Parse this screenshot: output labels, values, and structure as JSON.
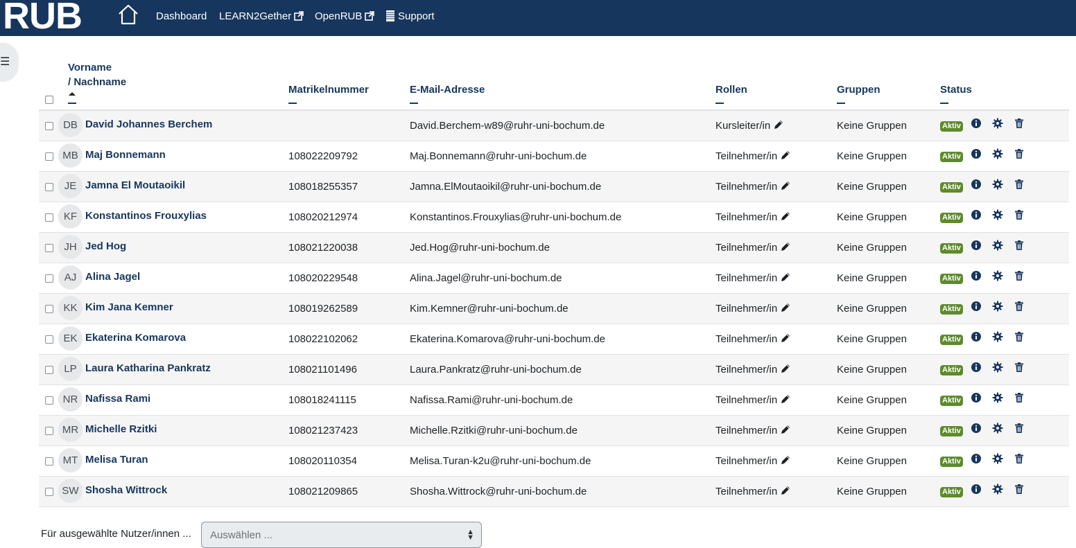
{
  "navbar": {
    "logo": "RUB",
    "links": [
      {
        "label": "Dashboard",
        "external": false
      },
      {
        "label": "LEARN2Gether",
        "external": true
      },
      {
        "label": "OpenRUB",
        "external": true
      },
      {
        "label": "Support",
        "icon": "support-icon"
      }
    ]
  },
  "table": {
    "headers": {
      "name_line1": "Vorname",
      "name_line2": "/ Nachname",
      "matrikel": "Matrikelnummer",
      "email": "E-Mail-Adresse",
      "roles": "Rollen",
      "groups": "Gruppen",
      "status": "Status"
    },
    "rows": [
      {
        "initials": "DB",
        "name": "David Johannes Berchem",
        "matrikel": "",
        "email": "David.Berchem-w89@ruhr-uni-bochum.de",
        "role": "Kursleiter/in",
        "groups": "Keine Gruppen",
        "status": "Aktiv"
      },
      {
        "initials": "MB",
        "name": "Maj Bonnemann",
        "matrikel": "108022209792",
        "email": "Maj.Bonnemann@ruhr-uni-bochum.de",
        "role": "Teilnehmer/in",
        "groups": "Keine Gruppen",
        "status": "Aktiv"
      },
      {
        "initials": "JE",
        "name": "Jamna El Moutaoikil",
        "matrikel": "108018255357",
        "email": "Jamna.ElMoutaoikil@ruhr-uni-bochum.de",
        "role": "Teilnehmer/in",
        "groups": "Keine Gruppen",
        "status": "Aktiv"
      },
      {
        "initials": "KF",
        "name": "Konstantinos Frouxylias",
        "matrikel": "108020212974",
        "email": "Konstantinos.Frouxylias@ruhr-uni-bochum.de",
        "role": "Teilnehmer/in",
        "groups": "Keine Gruppen",
        "status": "Aktiv"
      },
      {
        "initials": "JH",
        "name": "Jed Hog",
        "matrikel": "108021220038",
        "email": "Jed.Hog@ruhr-uni-bochum.de",
        "role": "Teilnehmer/in",
        "groups": "Keine Gruppen",
        "status": "Aktiv"
      },
      {
        "initials": "AJ",
        "name": "Alina Jagel",
        "matrikel": "108020229548",
        "email": "Alina.Jagel@ruhr-uni-bochum.de",
        "role": "Teilnehmer/in",
        "groups": "Keine Gruppen",
        "status": "Aktiv"
      },
      {
        "initials": "KK",
        "name": "Kim Jana Kemner",
        "matrikel": "108019262589",
        "email": "Kim.Kemner@ruhr-uni-bochum.de",
        "role": "Teilnehmer/in",
        "groups": "Keine Gruppen",
        "status": "Aktiv"
      },
      {
        "initials": "EK",
        "name": "Ekaterina Komarova",
        "matrikel": "108022102062",
        "email": "Ekaterina.Komarova@ruhr-uni-bochum.de",
        "role": "Teilnehmer/in",
        "groups": "Keine Gruppen",
        "status": "Aktiv"
      },
      {
        "initials": "LP",
        "name": "Laura Katharina Pankratz",
        "matrikel": "108021101496",
        "email": "Laura.Pankratz@ruhr-uni-bochum.de",
        "role": "Teilnehmer/in",
        "groups": "Keine Gruppen",
        "status": "Aktiv"
      },
      {
        "initials": "NR",
        "name": "Nafissa Rami",
        "matrikel": "108018241115",
        "email": "Nafissa.Rami@ruhr-uni-bochum.de",
        "role": "Teilnehmer/in",
        "groups": "Keine Gruppen",
        "status": "Aktiv"
      },
      {
        "initials": "MR",
        "name": "Michelle Rzitki",
        "matrikel": "108021237423",
        "email": "Michelle.Rzitki@ruhr-uni-bochum.de",
        "role": "Teilnehmer/in",
        "groups": "Keine Gruppen",
        "status": "Aktiv"
      },
      {
        "initials": "MT",
        "name": "Melisa Turan",
        "matrikel": "108020110354",
        "email": "Melisa.Turan-k2u@ruhr-uni-bochum.de",
        "role": "Teilnehmer/in",
        "groups": "Keine Gruppen",
        "status": "Aktiv"
      },
      {
        "initials": "SW",
        "name": "Shosha Wittrock",
        "matrikel": "108021209865",
        "email": "Shosha.Wittrock@ruhr-uni-bochum.de",
        "role": "Teilnehmer/in",
        "groups": "Keine Gruppen",
        "status": "Aktiv"
      }
    ]
  },
  "bulk": {
    "label": "Für ausgewählte Nutzer/innen ...",
    "placeholder": "Auswählen ..."
  },
  "colors": {
    "navbar": "#17365d",
    "badge": "#5d8b2a",
    "link": "#17365d"
  }
}
